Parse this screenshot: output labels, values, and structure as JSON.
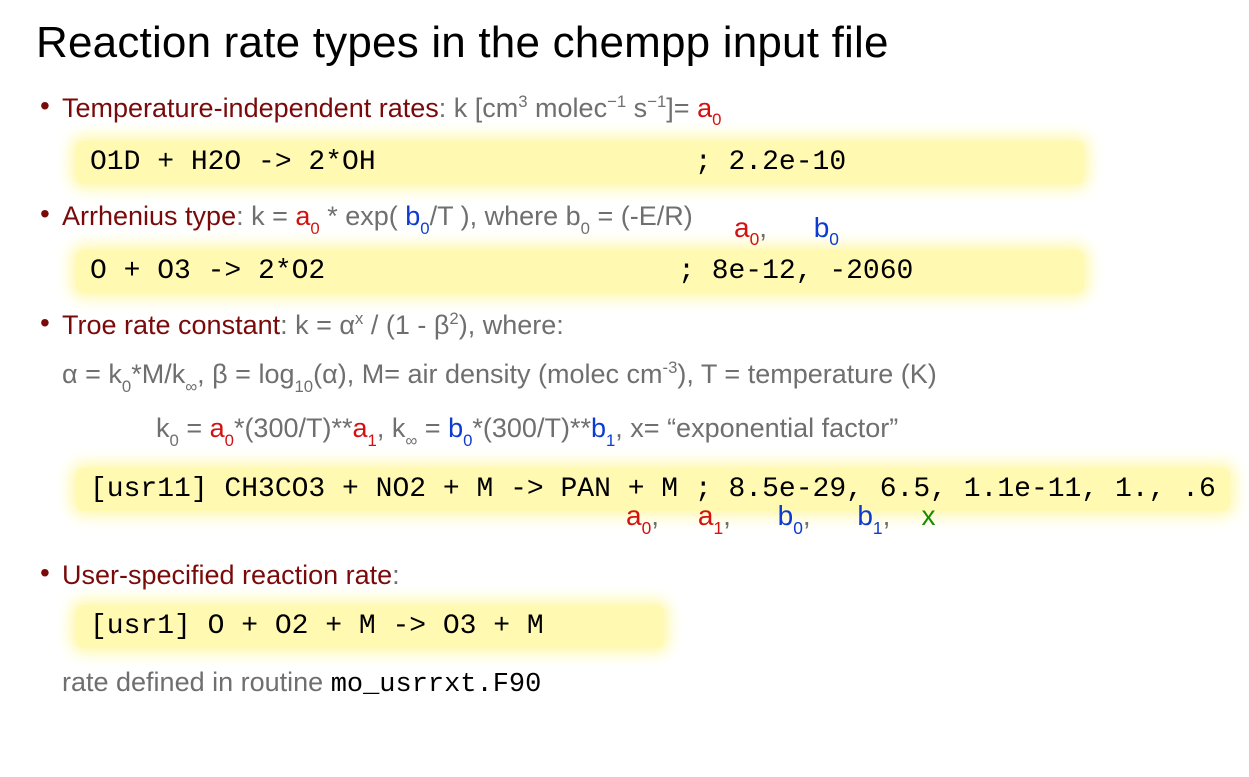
{
  "title": "Reaction rate types in the chempp input file",
  "sections": {
    "tempIndependent": {
      "label": "Temperature-independent rates",
      "formula_prefix": ": k [cm",
      "formula_mid": " molec",
      "formula_sup1": "3",
      "formula_sup2": "−",
      "formula_sup2b": "1",
      "formula_s": " s",
      "formula_sup3": "−",
      "formula_sup3b": "1",
      "formula_equals": "]= ",
      "a0": "a",
      "a0_sub": "0",
      "code": "O1D + H2O -> 2*OH                   ; 2.2e-10"
    },
    "arrhenius": {
      "label": "Arrhenius type",
      "formula_pref": ": k = ",
      "a0": "a",
      "a0_sub": "0",
      "star_exp": " * exp( ",
      "b0": "b",
      "b0_sub": "0",
      "over_t": "/T ), where b",
      "b0s": "0",
      "eq_er": " = (-E/R)",
      "annot_a0": "a",
      "annot_a0_sub": "0",
      "annot_comma": ",",
      "annot_b0": "b",
      "annot_b0_sub": "0",
      "code": "O + O3 -> 2*O2                     ; 8e-12, -2060"
    },
    "troe": {
      "label": "Troe rate constant",
      "formula_pref": ": k = α",
      "formula_x": "x",
      "formula_div": " / (1 - β",
      "formula_sq": "2",
      "formula_close": "), where:",
      "line2_alpha": "α = k",
      "line2_sub0": "0",
      "line2_mk": "*M/k",
      "line2_inf": "∞",
      "line2_betalog": ",   β = log",
      "line2_ten": "10",
      "line2_paren": "(α),  M= air density (molec cm",
      "line2_m3": "-3",
      "line2_tt": "), T = temperature (K)",
      "line3_k0": "k",
      "line3_k0s": "0",
      "line3_eq": " = ",
      "line3_a0": "a",
      "line3_a0s": "0",
      "line3_mid": "*(300/T)**",
      "line3_a1": "a",
      "line3_a1s": "1",
      "line3_comma": ",  k",
      "line3_inf": "∞",
      "line3_eq2": " = ",
      "line3_b0": "b",
      "line3_b0s": "0",
      "line3_mid2": "*(300/T)**",
      "line3_b1": "b",
      "line3_b1s": "1",
      "line3_tail": ", x= “exponential factor”",
      "code": "[usr11] CH3CO3 + NO2 + M -> PAN + M ; 8.5e-29, 6.5, 1.1e-11, 1., .6",
      "ann_a0": "a",
      "ann_a0s": "0",
      "ann_a1": "a",
      "ann_a1s": "1",
      "ann_b0": "b",
      "ann_b0s": "0",
      "ann_b1": "b",
      "ann_b1s": "1",
      "ann_x": "x",
      "ann_comma": ","
    },
    "userSpecified": {
      "label": "User-specified reaction rate",
      "colon": ":",
      "code": "[usr1] O + O2 + M -> O3 + M",
      "note_prefix": "rate defined in routine ",
      "note_mono": "mo_usrrxt.F90"
    }
  }
}
